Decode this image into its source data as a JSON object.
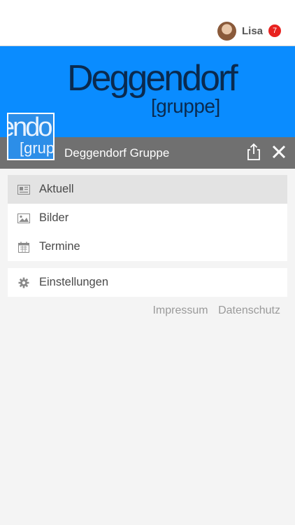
{
  "user": {
    "name": "Lisa",
    "notification_count": "7"
  },
  "banner": {
    "logo_word": "Deggendorf",
    "logo_sub": "[gruppe]"
  },
  "thumbnail": {
    "text_top": "endo",
    "text_bottom": "[grup"
  },
  "group_bar": {
    "title": "Deggendorf Gruppe"
  },
  "menu": {
    "items": [
      {
        "label": "Aktuell",
        "icon": "newspaper-icon",
        "active": true
      },
      {
        "label": "Bilder",
        "icon": "image-icon",
        "active": false
      },
      {
        "label": "Termine",
        "icon": "calendar-icon",
        "active": false
      }
    ],
    "settings": {
      "label": "Einstellungen",
      "icon": "gear-icon"
    }
  },
  "footer_links": {
    "impressum": "Impressum",
    "datenschutz": "Datenschutz"
  },
  "colors": {
    "banner": "#0a8cff",
    "group_bar": "#707070",
    "badge": "#e8221f"
  }
}
